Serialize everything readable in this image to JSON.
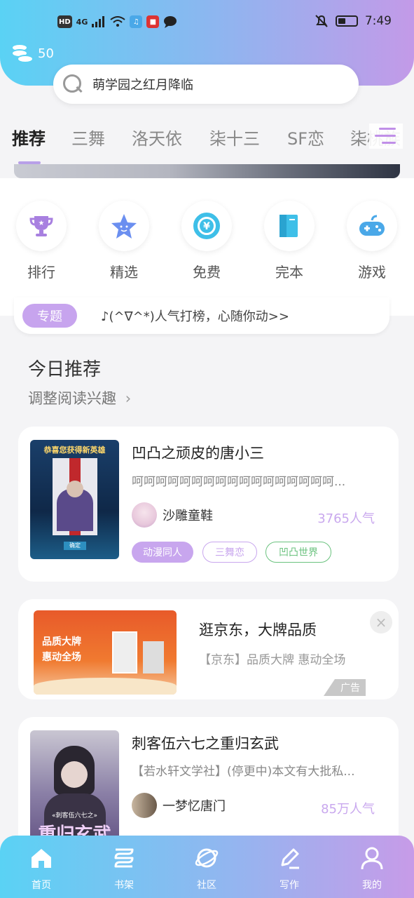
{
  "status_bar": {
    "left_chips": [
      "HD",
      "4G"
    ],
    "time": "7:49"
  },
  "coins": {
    "count": "50"
  },
  "search": {
    "text": "萌学园之红月降临"
  },
  "tabs": [
    {
      "label": "推荐",
      "active": true
    },
    {
      "label": "三舞"
    },
    {
      "label": "洛天依"
    },
    {
      "label": "柒十三"
    },
    {
      "label": "SF恋"
    },
    {
      "label": "柒桃族"
    }
  ],
  "categories": [
    {
      "label": "排行",
      "icon": "trophy-icon"
    },
    {
      "label": "精选",
      "icon": "star-icon"
    },
    {
      "label": "免费",
      "icon": "yen-icon"
    },
    {
      "label": "完本",
      "icon": "book-icon"
    },
    {
      "label": "游戏",
      "icon": "gamepad-icon"
    }
  ],
  "topic": {
    "badge": "专题",
    "text": "♪(^∇^*)人气打榜，心随你动>>"
  },
  "today": {
    "title": "今日推荐",
    "subtitle": "调整阅读兴趣"
  },
  "books": [
    {
      "title": "凹凸之顽皮的唐小三",
      "desc": "呵呵呵呵呵呵呵呵呵呵呵呵呵呵呵呵呵...",
      "author": "沙雕童鞋",
      "popularity": "3765人气",
      "cover_text": "恭喜您获得新英雄",
      "cover_button": "确定",
      "tags": [
        "动漫同人",
        "三舞恋",
        "凹凸世界"
      ]
    },
    {
      "title": "刺客伍六七之重归玄武",
      "desc": "【若水轩文学社】(停更中)本文有大批私...",
      "author": "一梦忆唐门",
      "popularity": "85万人气",
      "cover_text": "重归玄武",
      "cover_small": "«刺客伍六七之»"
    }
  ],
  "ad": {
    "title": "逛京东，大牌品质",
    "desc": "【京东】品质大牌 惠动全场",
    "label": "广告",
    "close": "×",
    "image_line1": "品质大牌",
    "image_line2": "惠动全场"
  },
  "nav": [
    {
      "label": "首页",
      "icon": "home-icon"
    },
    {
      "label": "书架",
      "icon": "bookshelf-icon"
    },
    {
      "label": "社区",
      "icon": "planet-icon"
    },
    {
      "label": "写作",
      "icon": "pen-icon"
    },
    {
      "label": "我的",
      "icon": "profile-icon"
    }
  ]
}
